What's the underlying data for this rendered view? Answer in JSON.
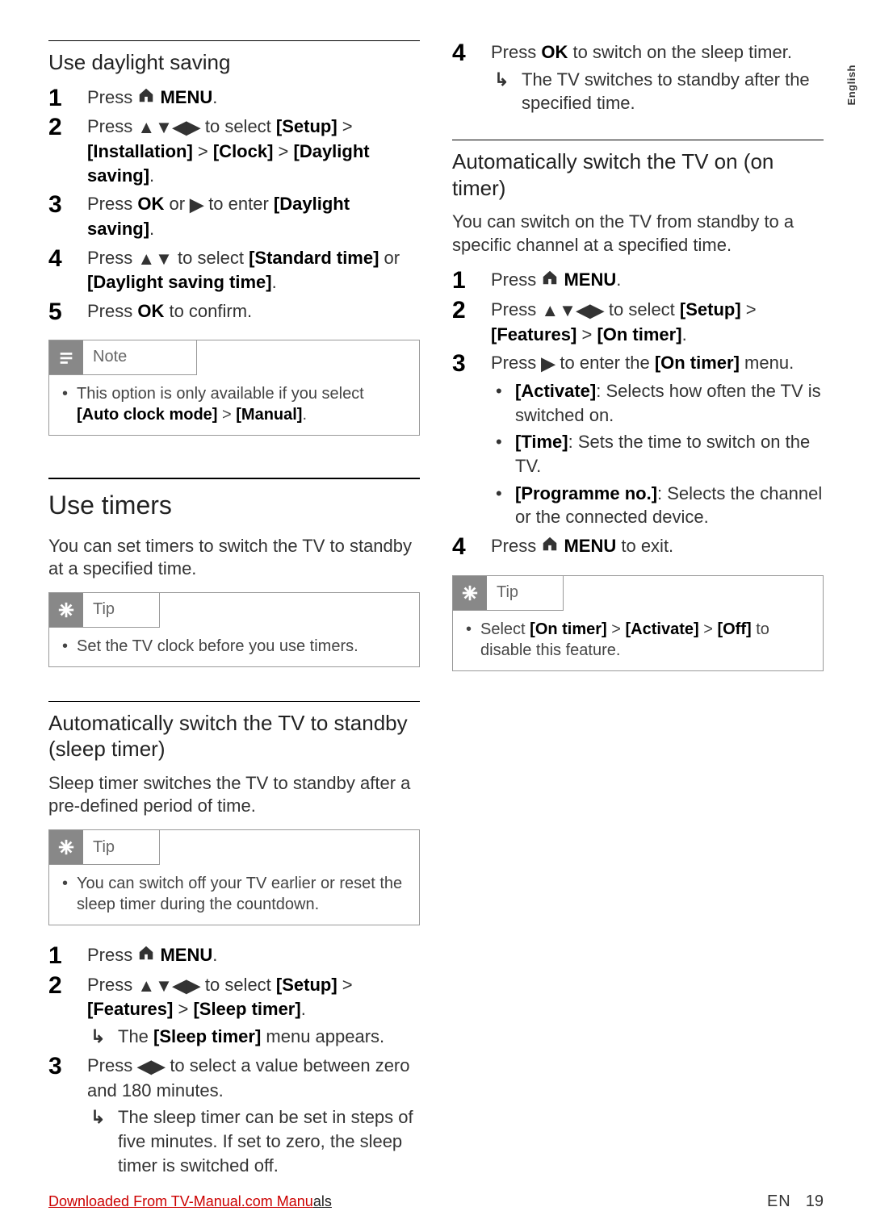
{
  "sideTab": "English",
  "leftCol": {
    "sec1": {
      "heading": "Use daylight saving",
      "steps": [
        {
          "pre": "Press ",
          "icon": "home",
          "post": " MENU",
          "tail": "."
        },
        {
          "pre": "Press ",
          "icon": "udlr",
          "post": " to select ",
          "b1": "[Setup]",
          "m1": " > ",
          "b2": "[Installation]",
          "m2": " > ",
          "b3": "[Clock]",
          "m3": " > ",
          "b4": "[Daylight saving]",
          "tail": "."
        },
        {
          "pre": "Press ",
          "b0": "OK",
          "m0": " or ",
          "icon": "right",
          "post": " to enter ",
          "b1": "[Daylight saving]",
          "tail": "."
        },
        {
          "pre": "Press ",
          "icon": "ud",
          "post": " to select ",
          "b1": "[Standard time]",
          "m1": " or ",
          "b2": "[Daylight saving time]",
          "tail": "."
        },
        {
          "pre": "Press ",
          "b0": "OK",
          "post": " to confirm."
        }
      ],
      "note": {
        "title": "Note",
        "body_a": "This option is only available if you select ",
        "body_b": "[Auto clock mode]",
        "body_c": " > ",
        "body_d": "[Manual]",
        "body_e": "."
      }
    },
    "sec2": {
      "heading": "Use timers",
      "intro": "You can set timers to switch the TV to standby at a specified time.",
      "tip": {
        "title": "Tip",
        "body": "Set the TV clock before you use timers."
      }
    },
    "sec3": {
      "heading": "Automatically switch the TV to standby (sleep timer)",
      "intro": "Sleep timer switches the TV to standby after a pre-defined period of time.",
      "tip": {
        "title": "Tip",
        "body": "You can switch off your TV earlier or reset the sleep timer during the countdown."
      },
      "steps": [
        {
          "pre": "Press ",
          "icon": "home",
          "post": " MENU",
          "tail": "."
        },
        {
          "pre": "Press ",
          "icon": "udlr",
          "post": " to select ",
          "b1": "[Setup]",
          "m1": " > ",
          "b2": "[Features]",
          "m2": " > ",
          "b3": "[Sleep timer]",
          "tail": ".",
          "arrow": {
            "a": "The ",
            "b": "[Sleep timer]",
            "c": " menu appears."
          }
        },
        {
          "pre": "Press ",
          "icon": "lr",
          "post": " to select a value between zero and 180 minutes.",
          "arrow": {
            "a": "The sleep timer can be set in steps of five minutes. If set to zero, the sleep timer is switched off."
          }
        }
      ]
    }
  },
  "rightCol": {
    "topStep": {
      "num": "4",
      "pre": "Press ",
      "b0": "OK",
      "post": " to switch on the sleep timer.",
      "arrow": "The TV switches to standby after the specified time."
    },
    "sec1": {
      "heading": "Automatically switch the TV on (on timer)",
      "intro": "You can switch on the TV from standby to a specific channel at a specified time.",
      "steps": [
        {
          "pre": "Press ",
          "icon": "home",
          "post": " MENU",
          "tail": "."
        },
        {
          "pre": "Press ",
          "icon": "udlr",
          "post": " to select ",
          "b1": "[Setup]",
          "m1": " > ",
          "b2": "[Features]",
          "m2": " > ",
          "b3": "[On timer]",
          "tail": "."
        },
        {
          "pre": "Press ",
          "icon": "right",
          "post": " to enter the ",
          "b1": "[On timer]",
          "tail": " menu.",
          "bullets": [
            {
              "b": "[Activate]",
              "t": ": Selects how often the TV is switched on."
            },
            {
              "b": "[Time]",
              "t": ": Sets the time to switch on the TV."
            },
            {
              "b": "[Programme no.]",
              "t": ": Selects the channel or the connected device."
            }
          ]
        },
        {
          "pre": "Press ",
          "icon": "home",
          "post": " MENU",
          "tail": " to exit."
        }
      ],
      "tip": {
        "title": "Tip",
        "a": "Select ",
        "b1": "[On timer]",
        "m1": " > ",
        "b2": "[Activate]",
        "m2": " > ",
        "b3": "[Off]",
        "c": " to disable this feature."
      }
    }
  },
  "footer": {
    "link_a": "Downloaded From TV-Manual.com Manu",
    "link_b": "als",
    "lang": "EN",
    "page": "19"
  }
}
